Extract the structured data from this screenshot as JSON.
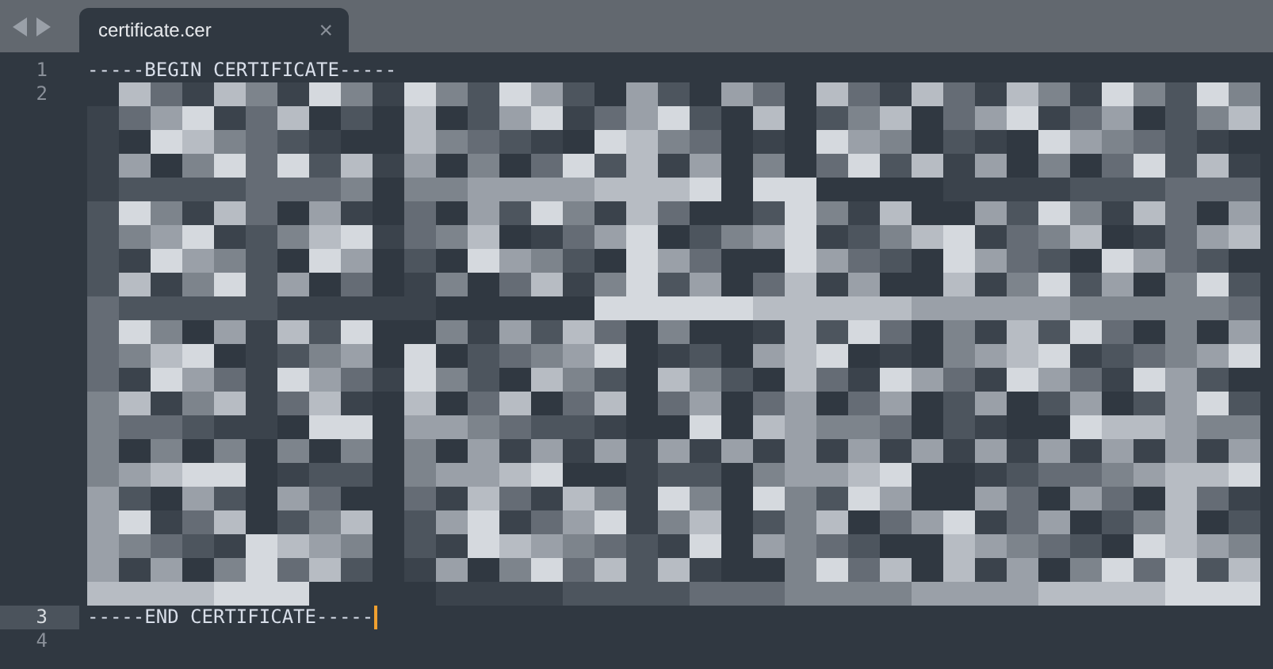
{
  "tabs": [
    {
      "label": "certificate.cer",
      "close": "×",
      "selected": true
    }
  ],
  "lines": [
    {
      "number": "1",
      "kind": "text",
      "text": "-----BEGIN CERTIFICATE-----",
      "current": false
    },
    {
      "number": "2",
      "kind": "redacted",
      "current": false
    },
    {
      "number": "3",
      "kind": "text",
      "text": "-----END CERTIFICATE-----",
      "current": true
    },
    {
      "number": "4",
      "kind": "text",
      "current": false
    }
  ]
}
